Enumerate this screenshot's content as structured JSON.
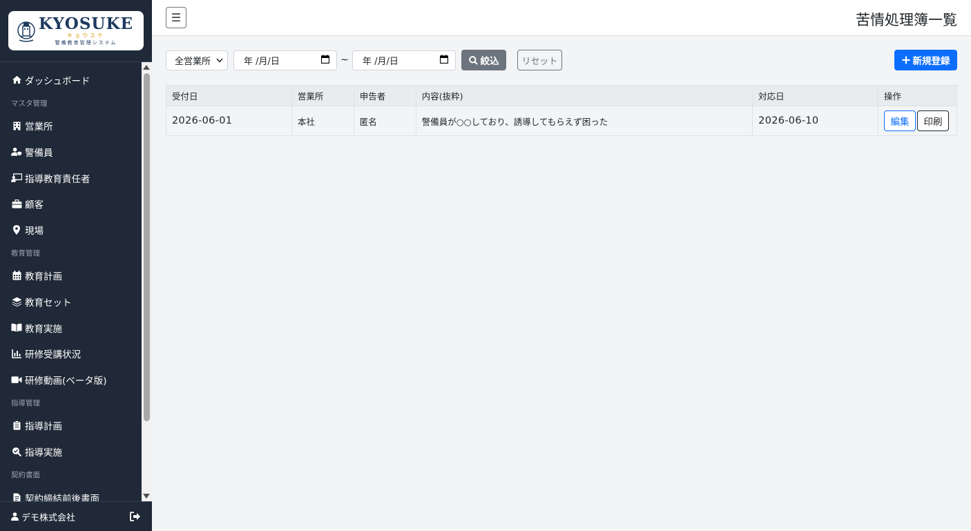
{
  "logo": {
    "main": "KYOSUKE",
    "kana": "キョウスケ",
    "sub": "警備教育管理システム"
  },
  "sidebar": {
    "items": [
      {
        "type": "item",
        "icon": "home-icon",
        "label": "ダッシュボード"
      },
      {
        "type": "section",
        "label": "マスタ管理"
      },
      {
        "type": "item",
        "icon": "building-icon",
        "label": "営業所"
      },
      {
        "type": "item",
        "icon": "user-shield-icon",
        "label": "警備員"
      },
      {
        "type": "item",
        "icon": "chalkboard-teacher-icon",
        "label": "指導教育責任者"
      },
      {
        "type": "item",
        "icon": "briefcase-icon",
        "label": "顧客"
      },
      {
        "type": "item",
        "icon": "map-pin-icon",
        "label": "現場"
      },
      {
        "type": "section",
        "label": "教育管理"
      },
      {
        "type": "item",
        "icon": "calendar-icon",
        "label": "教育計画"
      },
      {
        "type": "item",
        "icon": "layers-icon",
        "label": "教育セット"
      },
      {
        "type": "item",
        "icon": "book-open-icon",
        "label": "教育実施"
      },
      {
        "type": "item",
        "icon": "chart-icon",
        "label": "研修受講状況"
      },
      {
        "type": "item",
        "icon": "video-icon",
        "label": "研修動画(ベータ版)"
      },
      {
        "type": "section",
        "label": "指導管理"
      },
      {
        "type": "item",
        "icon": "clipboard-icon",
        "label": "指導計画"
      },
      {
        "type": "item",
        "icon": "search-check-icon",
        "label": "指導実施"
      },
      {
        "type": "section",
        "label": "契約書面"
      },
      {
        "type": "item",
        "icon": "file-contract-icon",
        "label": "契約締結前後書面"
      }
    ],
    "footer_user": "デモ株式会社"
  },
  "header": {
    "menu_icon": "☰",
    "title": "苦情処理簿一覧"
  },
  "filter": {
    "office_select": "全営業所",
    "date_from": "年 /月/日",
    "tilde": "~",
    "date_to": "年 /月/日",
    "search_label": "絞込",
    "reset_label": "リセット",
    "new_label": "新規登録"
  },
  "table": {
    "headers": [
      "受付日",
      "営業所",
      "申告者",
      "内容(抜粋)",
      "対応日",
      "操作"
    ],
    "rows": [
      {
        "received": "2026-06-01",
        "office": "本社",
        "reporter": "匿名",
        "content": "警備員が○○しており、誘導してもらえず困った",
        "responded": "2026-06-10",
        "edit": "編集",
        "print": "印刷"
      }
    ]
  },
  "colors": {
    "sidebar_bg": "#1f2937",
    "primary": "#0d6efd",
    "secondary": "#6c757d",
    "logo_navy": "#1e3a5f",
    "logo_gold": "#d4a017"
  }
}
